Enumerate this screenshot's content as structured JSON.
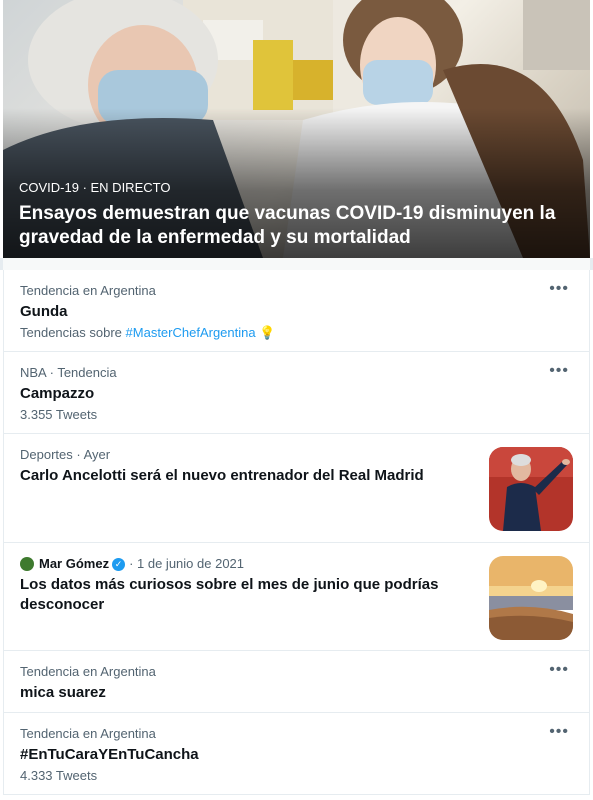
{
  "hero": {
    "meta": "COVID-19 · EN DIRECTO",
    "headline": "Ensayos demuestran que vacunas COVID-19 disminuyen la gravedad de la enfermedad y su mortalidad"
  },
  "items": [
    {
      "subtitle": "Tendencia en Argentina",
      "title": "Gunda",
      "related_prefix": "Tendencias sobre",
      "related_hashtag": "#MasterChefArgentina",
      "related_emoji": "💡"
    },
    {
      "subtitle": "NBA · Tendencia",
      "title": "Campazzo",
      "count": "3.355 Tweets"
    },
    {
      "subtitle": "Deportes · Ayer",
      "title": "Carlo Ancelotti será el nuevo entrenador del Real Madrid"
    },
    {
      "author": "Mar Gómez",
      "date": "· 1 de junio de 2021",
      "title": "Los datos más curiosos sobre el mes de junio que podrías desconocer"
    },
    {
      "subtitle": "Tendencia en Argentina",
      "title": "mica suarez"
    },
    {
      "subtitle": "Tendencia en Argentina",
      "title": "#EnTuCaraYEnTuCancha",
      "count": "4.333 Tweets"
    }
  ],
  "more_label": "•••",
  "verified_mark": "✓",
  "colors": {
    "accent": "#1d9bf0",
    "secondary_text": "#536471",
    "border": "#e6ecf0"
  },
  "icons": [
    "more-options-icon",
    "verified-badge-icon",
    "lightbulb-emoji-icon"
  ]
}
